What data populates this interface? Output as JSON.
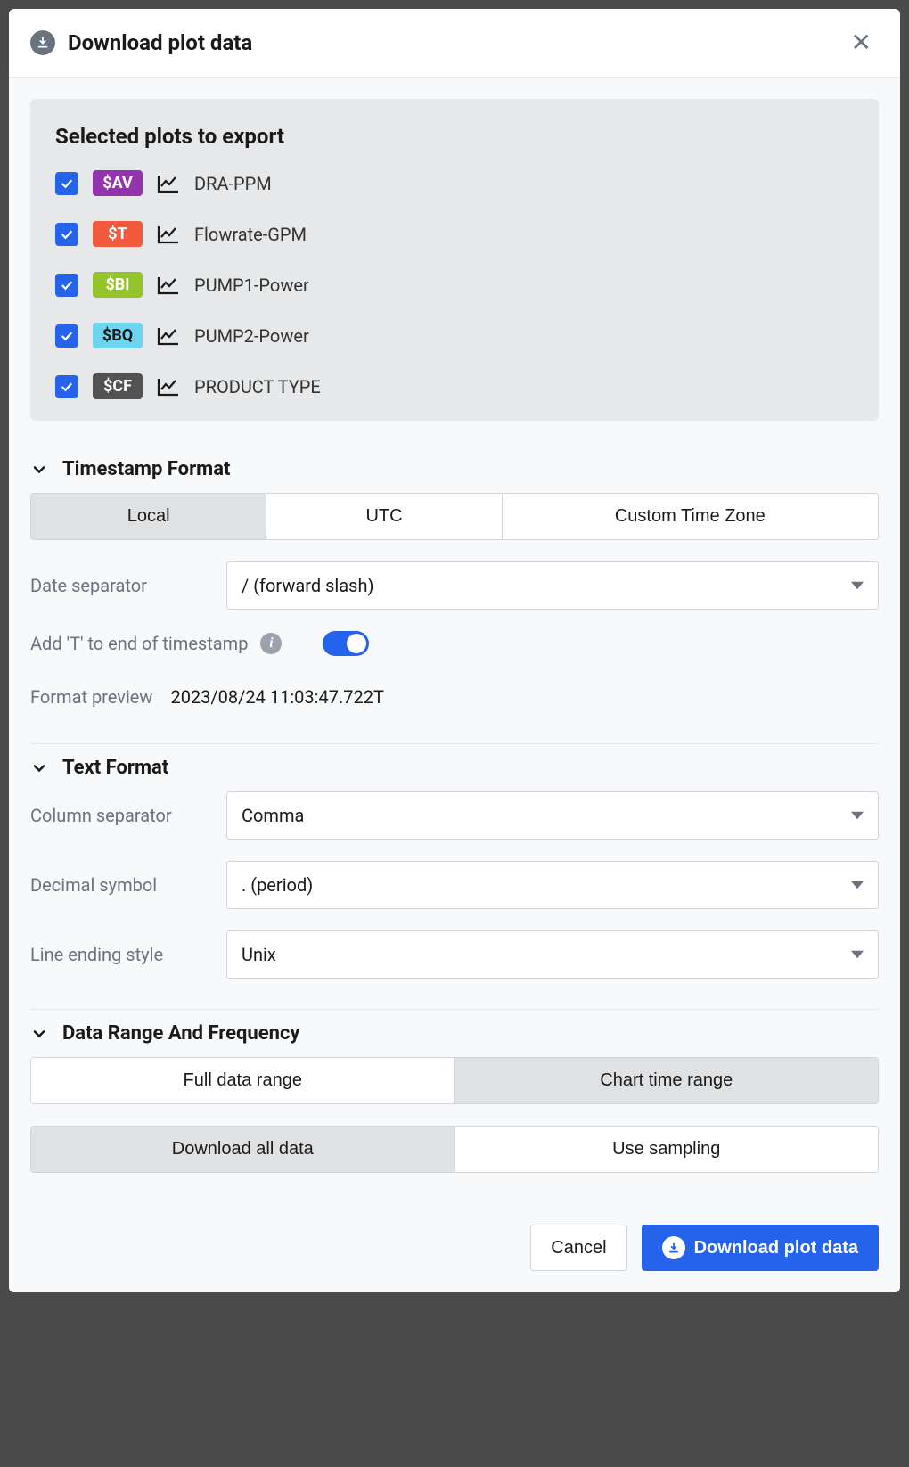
{
  "dialog": {
    "title": "Download plot data"
  },
  "plots": {
    "title": "Selected plots to export",
    "items": [
      {
        "checked": true,
        "tag": "$AV",
        "tag_color": "#9333ae",
        "name": "DRA-PPM"
      },
      {
        "checked": true,
        "tag": "$T",
        "tag_color": "#f15a3c",
        "name": "Flowrate-GPM"
      },
      {
        "checked": true,
        "tag": "$BI",
        "tag_color": "#93c52a",
        "name": "PUMP1-Power"
      },
      {
        "checked": true,
        "tag": "$BQ",
        "tag_color": "#6dd5ed",
        "tag_text": "#1a1a1a",
        "name": "PUMP2-Power"
      },
      {
        "checked": true,
        "tag": "$CF",
        "tag_color": "#525252",
        "name": "PRODUCT TYPE"
      }
    ]
  },
  "sections": {
    "timestamp": {
      "title": "Timestamp Format",
      "options": {
        "local": "Local",
        "utc": "UTC",
        "custom": "Custom Time Zone"
      },
      "selected": "local",
      "date_separator_label": "Date separator",
      "date_separator_value": "/ (forward slash)",
      "add_t_label": "Add 'T' to end of timestamp",
      "add_t_on": true,
      "preview_label": "Format preview",
      "preview_value": "2023/08/24 11:03:47.722T"
    },
    "text": {
      "title": "Text Format",
      "col_sep_label": "Column separator",
      "col_sep_value": "Comma",
      "dec_label": "Decimal symbol",
      "dec_value": ". (period)",
      "line_label": "Line ending style",
      "line_value": "Unix"
    },
    "range": {
      "title": "Data Range And Frequency",
      "full": "Full data range",
      "chart": "Chart time range",
      "range_selected": "chart",
      "download_all": "Download all data",
      "use_sampling": "Use sampling",
      "sampling_selected": "download_all"
    }
  },
  "footer": {
    "cancel": "Cancel",
    "download": "Download plot data"
  }
}
